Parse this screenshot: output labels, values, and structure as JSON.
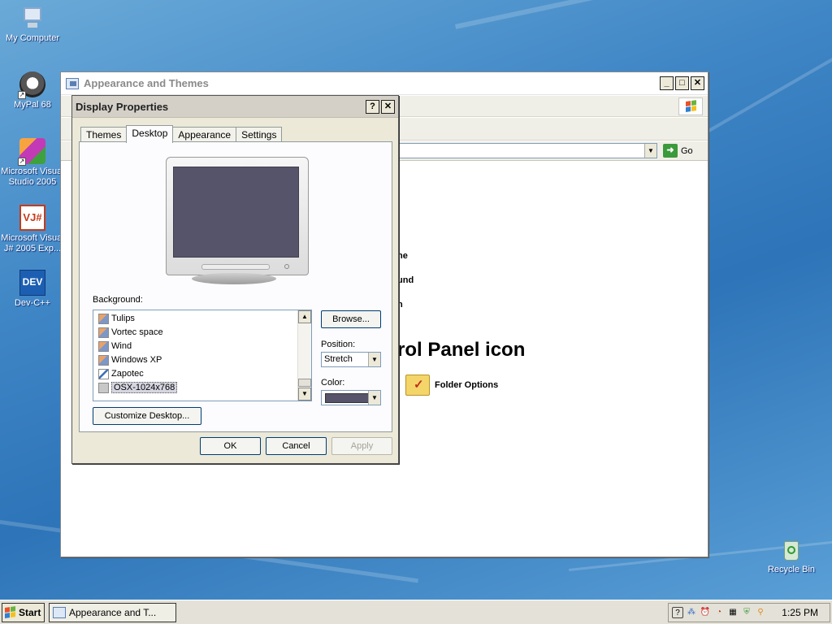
{
  "desktop": {
    "icons": [
      {
        "label": "My Computer"
      },
      {
        "label": "MyPal 68"
      },
      {
        "label": "Microsoft Visual Studio 2005"
      },
      {
        "label": "Microsoft Visual J# 2005 Exp..."
      },
      {
        "label": "Dev-C++"
      },
      {
        "label": "Recycle Bin"
      }
    ],
    "vj_glyph": "VJ#",
    "dev_glyph": "DEV"
  },
  "explorer": {
    "title": "Appearance and Themes",
    "go_label": "Go",
    "task_fragments": [
      "ne",
      "und",
      "n"
    ],
    "heading_fragment": "rol Panel icon",
    "folder_options_label": "Folder Options"
  },
  "dialog": {
    "title": "Display Properties",
    "help_label": "?",
    "close_label": "✕",
    "tabs": [
      "Themes",
      "Desktop",
      "Appearance",
      "Settings"
    ],
    "active_tab": "Desktop",
    "background_label": "Background:",
    "backgrounds": [
      "Tulips",
      "Vortec space",
      "Wind",
      "Windows XP",
      "Zapotec",
      "OSX-1024x768"
    ],
    "selected_background": "OSX-1024x768",
    "browse_label": "Browse...",
    "position_label": "Position:",
    "position_value": "Stretch",
    "color_label": "Color:",
    "color_value": "#55546a",
    "customize_label": "Customize Desktop...",
    "ok_label": "OK",
    "cancel_label": "Cancel",
    "apply_label": "Apply"
  },
  "taskbar": {
    "start_label": "Start",
    "task_label": "Appearance and T...",
    "clock": "1:25 PM"
  }
}
